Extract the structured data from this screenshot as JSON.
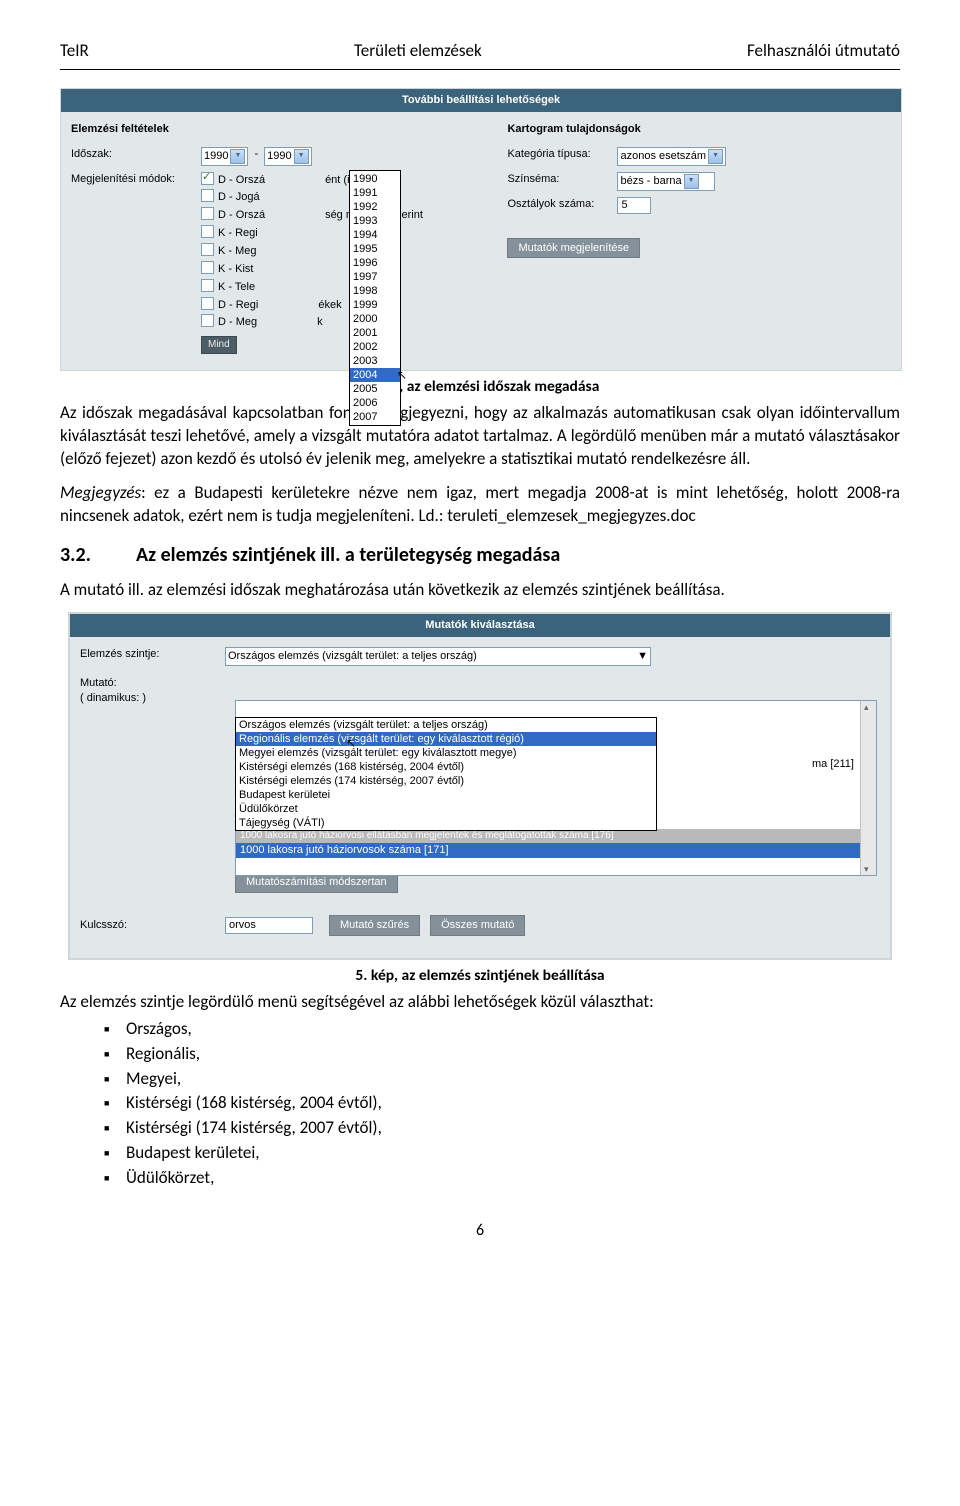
{
  "header": {
    "left": "TeIR",
    "center": "Területi elemzések",
    "right": "Felhasználói útmutató"
  },
  "shot1": {
    "title": "További beállítási lehetőségek",
    "left_heading": "Elemzési feltételek",
    "right_heading": "Kartogram tulajdonságok",
    "idoszak_label": "Időszak:",
    "sel_from": "1990",
    "sel_dash": "-",
    "sel_to": "1990",
    "modok_label": "Megjelenítési módok:",
    "mod_items": [
      "D - Orszá",
      "D - Jogá",
      "D - Orszá",
      "K - Regi",
      "K - Meg",
      "K - Kist",
      "K - Tele",
      "D - Regi",
      "D - Meg"
    ],
    "mod_suffix_0": "ént (idősor)",
    "mod_suffix_3": "ség nagyság szerint",
    "mod_suffix_7": "ékek",
    "mod_suffix_8": "k",
    "mind_btn": "Mind",
    "kat_label": "Kategória típusa:",
    "kat_sel": "azonos esetszám",
    "szin_label": "Színséma:",
    "szin_sel": "bézs - barna",
    "oszt_label": "Osztályok száma:",
    "oszt_val": "5",
    "show_btn": "Mutatók megjelenítése",
    "dd_years": [
      "1990",
      "1991",
      "1992",
      "1993",
      "1994",
      "1995",
      "1996",
      "1997",
      "1998",
      "1999",
      "2000",
      "2001",
      "2002",
      "2003"
    ],
    "dd_year_sel": "2004",
    "dd_years_after": [
      "2005",
      "2006",
      "2007"
    ]
  },
  "caption1": "4. kép, az elemzési időszak megadása",
  "para1": "Az időszak megadásával kapcsolatban fontos megjegyezni, hogy az alkalmazás automatikusan csak olyan időintervallum kiválasztását teszi lehetővé, amely a vizsgált mutatóra adatot tartalmaz. A legördülő menüben már a mutató választásakor (előző fejezet) azon kezdő és utolsó év jelenik meg, amelyekre a statisztikai mutató rendelkezésre áll.",
  "para1b_prefix": "Megjegyzés",
  "para1b": ": ez a Budapesti kerületekre nézve nem igaz, mert megadja 2008-at is mint lehetőség, holott 2008-ra nincsenek adatok, ezért nem is tudja megjeleníteni. Ld.: teruleti_elemzesek_megjegyzes.doc",
  "h3_num": "3.2.",
  "h3_txt": "Az elemzés szintjének ill. a területegység megadása",
  "para2": "A mutató ill. az elemzési időszak meghatározása után következik az elemzés szintjének beállítása.",
  "shot2": {
    "title": "Mutatók kiválasztása",
    "szint_label": "Elemzés szintje:",
    "szint_sel": "Országos elemzés (vizsgált terület: a teljes ország)",
    "mutato_label": "Mutató:",
    "din_label": "( dinamikus:       )",
    "dd": [
      "Országos elemzés (vizsgált terület: a teljes ország)",
      "Regionális elemzés (vizsgált terület: egy kiválasztott régió)",
      "Megyei elemzés (vizsgált terület: egy kiválasztott megye)",
      "Kistérségi elemzés (168 kistérség, 2004 évtől)",
      "Kistérségi elemzés (174 kistérség, 2007 évtől)",
      "Budapest kerületei",
      "Üdülőkörzet",
      "Tájegység (VÁTI)"
    ],
    "list_frag": "ma [211]",
    "list_grey": "1000 lakosra jutó háziorvosi ellátásban megjelentek és meglátogatottak száma [176]",
    "list_blue": "1000 lakosra jutó háziorvosok száma [171]",
    "mod_btn": "Mutatószámítási módszertan",
    "kw_label": "Kulcsszó:",
    "kw_val": "orvos",
    "filt_btn": "Mutató szűrés",
    "all_btn": "Összes mutató"
  },
  "caption2": "5. kép, az elemzés szintjének beállítása",
  "para3": "Az elemzés szintje legördülő menü segítségével az alábbi lehetőségek közül választhat:",
  "bullets": [
    "Országos,",
    "Regionális,",
    "Megyei,",
    "Kistérségi (168 kistérség, 2004 évtől),",
    "Kistérségi (174 kistérség, 2007 évtől),",
    "Budapest kerületei,",
    "Üdülőkörzet,"
  ],
  "page": "6"
}
